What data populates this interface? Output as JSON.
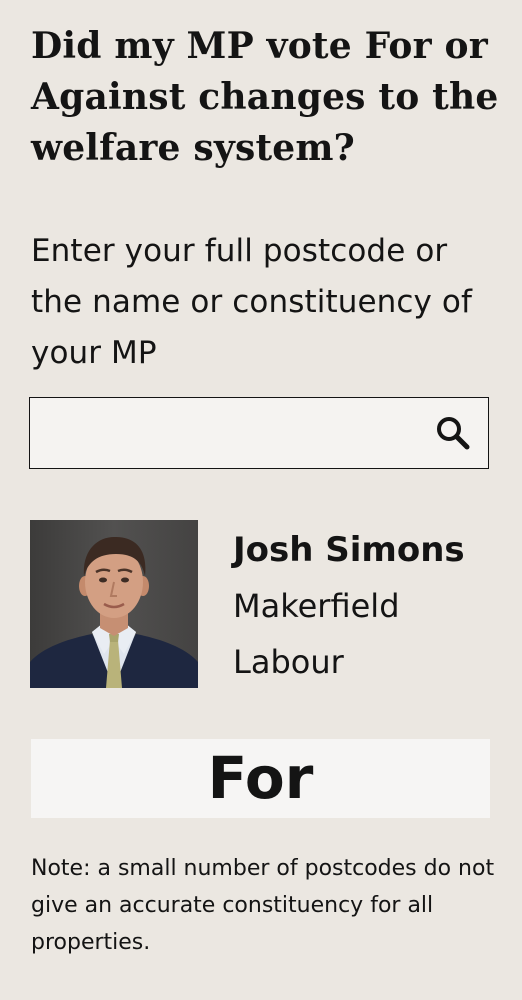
{
  "headline": "Did my MP vote For or Against changes to the welfare system?",
  "instructions": "Enter your full postcode or the name or constituency of your MP",
  "search": {
    "value": "",
    "icon": "search-icon"
  },
  "mp": {
    "name": "Josh Simons",
    "constituency": "Makerfield",
    "party": "Labour"
  },
  "vote": {
    "result": "For"
  },
  "note": "Note: a small number of postcodes do not give an accurate constituency for all properties.",
  "colors": {
    "background": "#ebe7e1",
    "text": "#141414",
    "input_background": "#f5f3f1",
    "vote_banner": "#f6f5f4"
  }
}
